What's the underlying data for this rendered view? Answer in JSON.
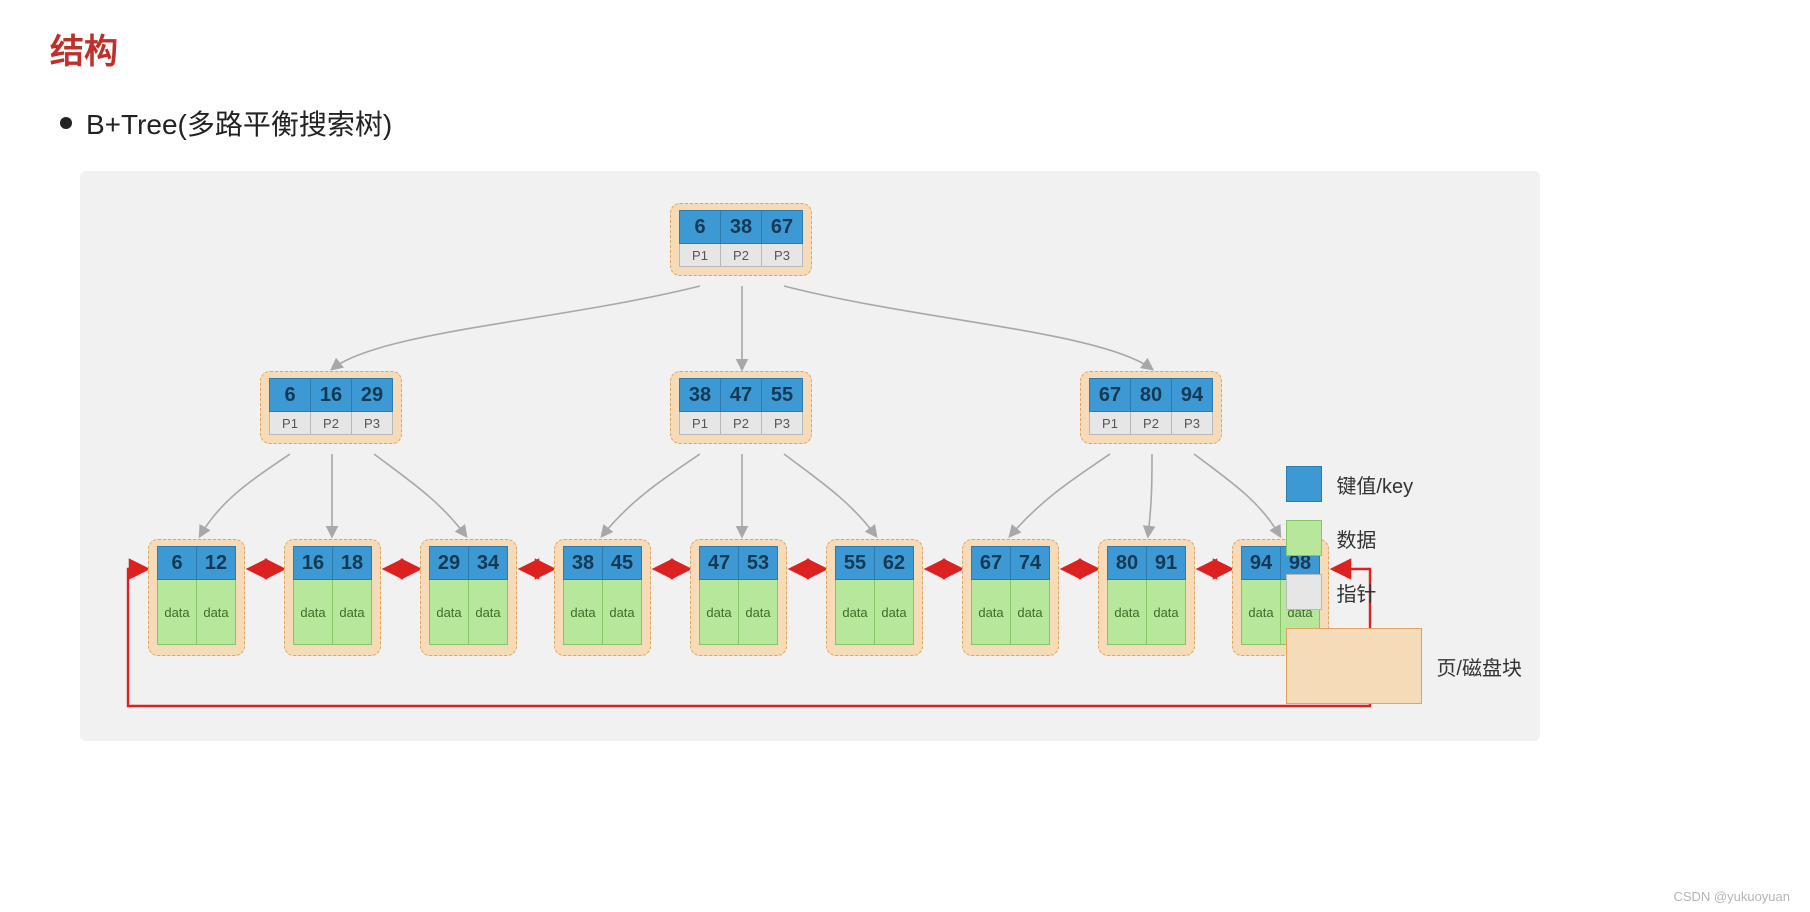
{
  "title": "结构",
  "bullet": "B+Tree(多路平衡搜索树)",
  "root": {
    "keys": [
      "6",
      "38",
      "67"
    ],
    "ptrs": [
      "P1",
      "P2",
      "P3"
    ]
  },
  "mids": [
    {
      "keys": [
        "6",
        "16",
        "29"
      ],
      "ptrs": [
        "P1",
        "P2",
        "P3"
      ]
    },
    {
      "keys": [
        "38",
        "47",
        "55"
      ],
      "ptrs": [
        "P1",
        "P2",
        "P3"
      ]
    },
    {
      "keys": [
        "67",
        "80",
        "94"
      ],
      "ptrs": [
        "P1",
        "P2",
        "P3"
      ]
    }
  ],
  "leaves": [
    {
      "keys": [
        "6",
        "12"
      ],
      "data": [
        "data",
        "data"
      ]
    },
    {
      "keys": [
        "16",
        "18"
      ],
      "data": [
        "data",
        "data"
      ]
    },
    {
      "keys": [
        "29",
        "34"
      ],
      "data": [
        "data",
        "data"
      ]
    },
    {
      "keys": [
        "38",
        "45"
      ],
      "data": [
        "data",
        "data"
      ]
    },
    {
      "keys": [
        "47",
        "53"
      ],
      "data": [
        "data",
        "data"
      ]
    },
    {
      "keys": [
        "55",
        "62"
      ],
      "data": [
        "data",
        "data"
      ]
    },
    {
      "keys": [
        "67",
        "74"
      ],
      "data": [
        "data",
        "data"
      ]
    },
    {
      "keys": [
        "80",
        "91"
      ],
      "data": [
        "data",
        "data"
      ]
    },
    {
      "keys": [
        "94",
        "98"
      ],
      "data": [
        "data",
        "data"
      ]
    }
  ],
  "legend": {
    "key": "键值/key",
    "data": "数据",
    "ptr": "指针",
    "page": "页/磁盘块"
  },
  "watermark": "CSDN @yukuoyuan"
}
